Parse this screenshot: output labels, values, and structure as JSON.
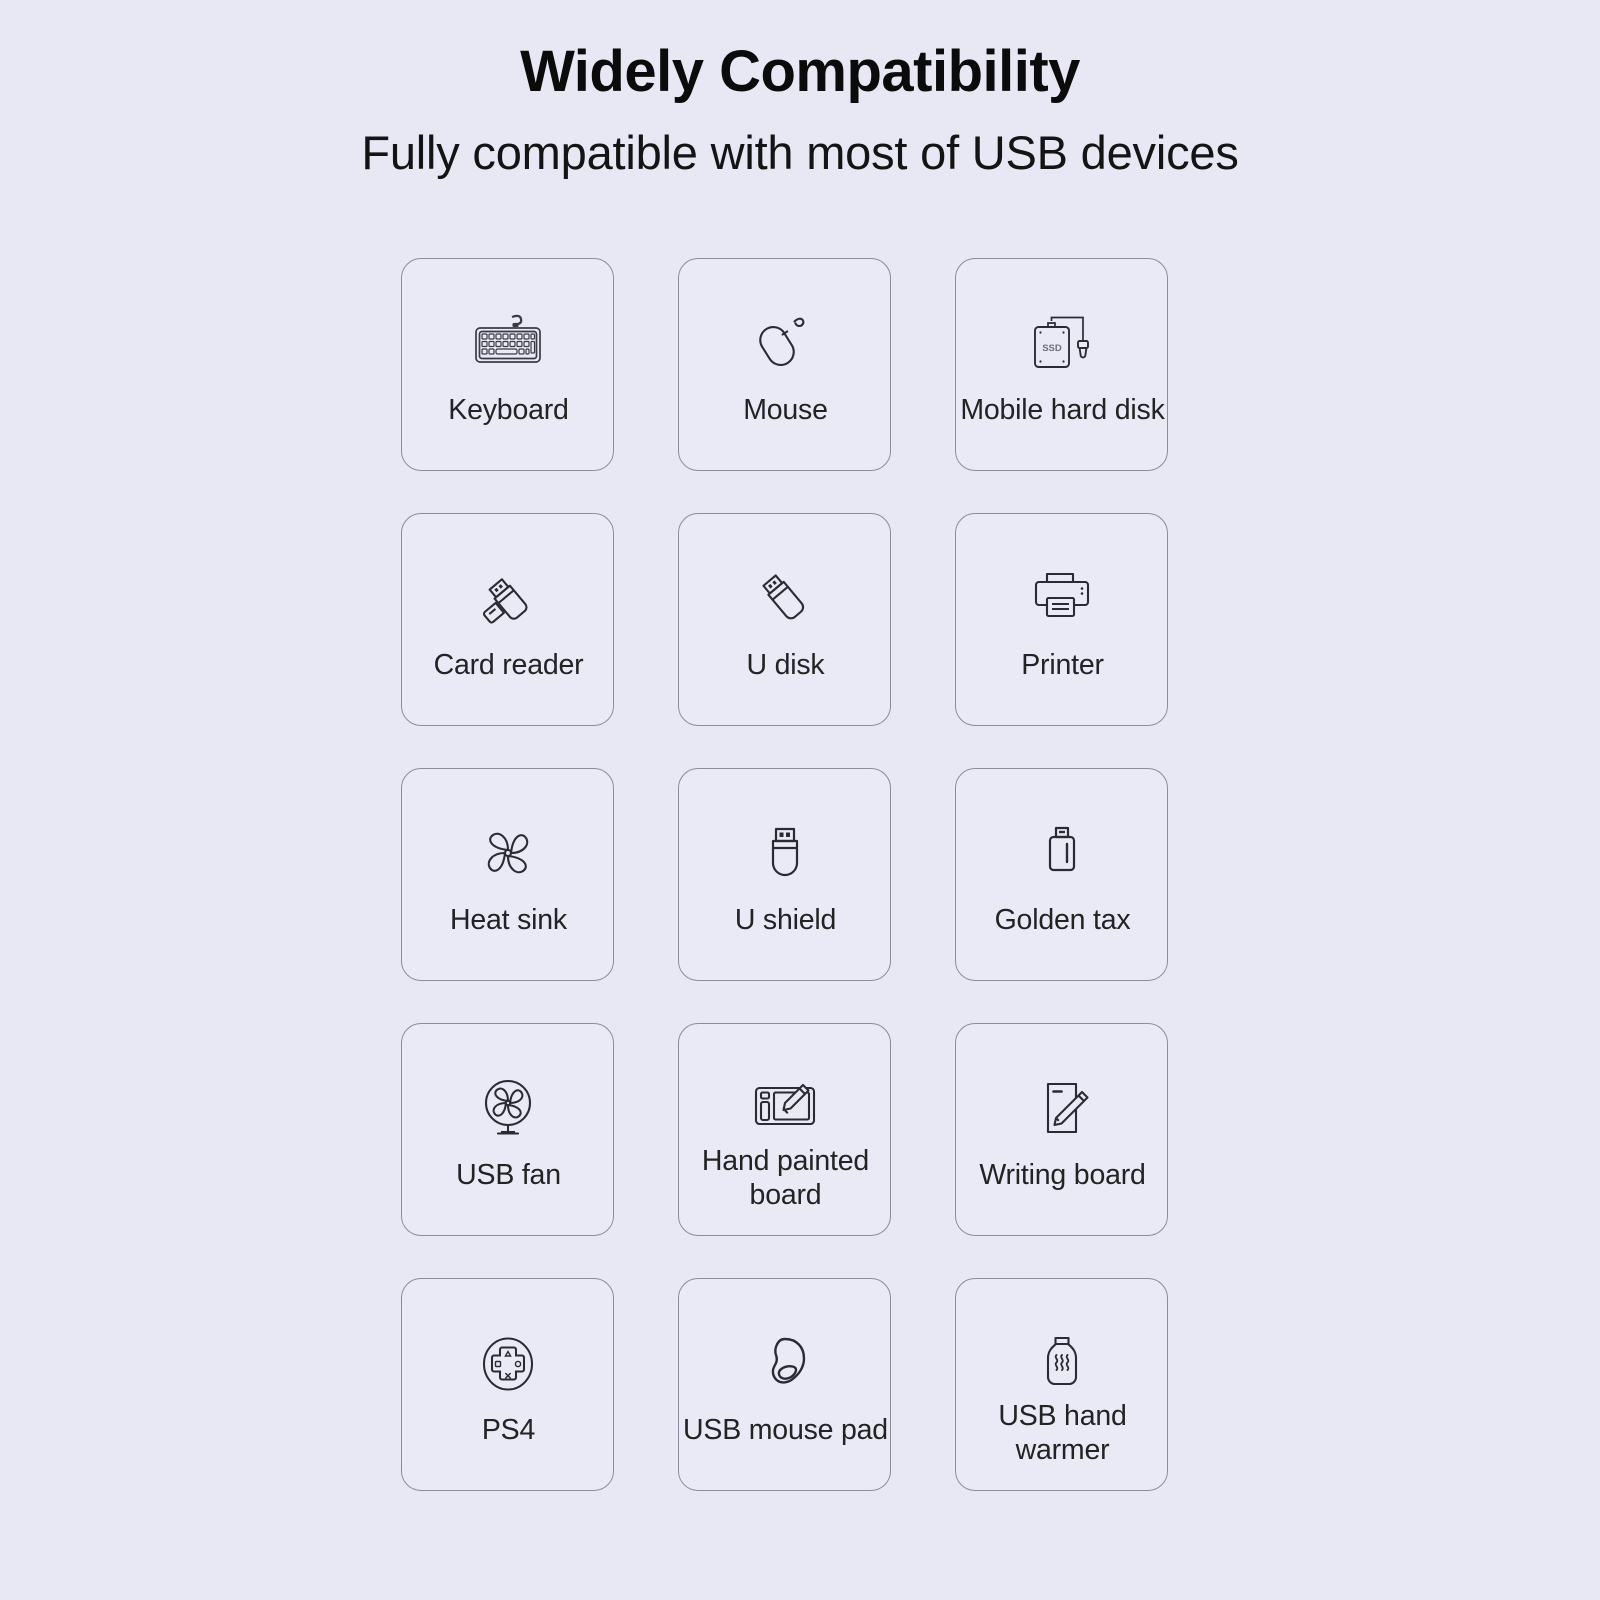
{
  "header": {
    "title": "Widely Compatibility",
    "subtitle": "Fully compatible with most of USB devices"
  },
  "grid": {
    "columns": 3,
    "rows": 5,
    "cards": [
      {
        "label": "Keyboard",
        "icon": "keyboard-icon"
      },
      {
        "label": "Mouse",
        "icon": "mouse-icon"
      },
      {
        "label": "Mobile hard disk",
        "icon": "ssd-hard-disk-icon",
        "icon_text": "SSD"
      },
      {
        "label": "Card reader",
        "icon": "card-reader-icon"
      },
      {
        "label": "U disk",
        "icon": "usb-flash-drive-icon"
      },
      {
        "label": "Printer",
        "icon": "printer-icon"
      },
      {
        "label": "Heat sink",
        "icon": "fan-blade-icon"
      },
      {
        "label": "U shield",
        "icon": "usb-token-icon"
      },
      {
        "label": "Golden tax",
        "icon": "usb-key-icon"
      },
      {
        "label": "USB fan",
        "icon": "desk-fan-icon"
      },
      {
        "label": "Hand painted\nboard",
        "icon": "drawing-tablet-icon"
      },
      {
        "label": "Writing board",
        "icon": "writing-tablet-icon"
      },
      {
        "label": "PS4",
        "icon": "gamepad-dpad-icon"
      },
      {
        "label": "USB mouse pad",
        "icon": "mouse-pad-icon"
      },
      {
        "label": "USB hand\nwarmer",
        "icon": "hand-warmer-icon"
      }
    ]
  },
  "colors": {
    "page_background": "#e7e8f4",
    "card_background": "#e9eaf5",
    "card_border": "#8a8d9c",
    "title_text": "#0b0b0b",
    "label_text": "#232323",
    "icon_stroke": "#2b2b33"
  }
}
